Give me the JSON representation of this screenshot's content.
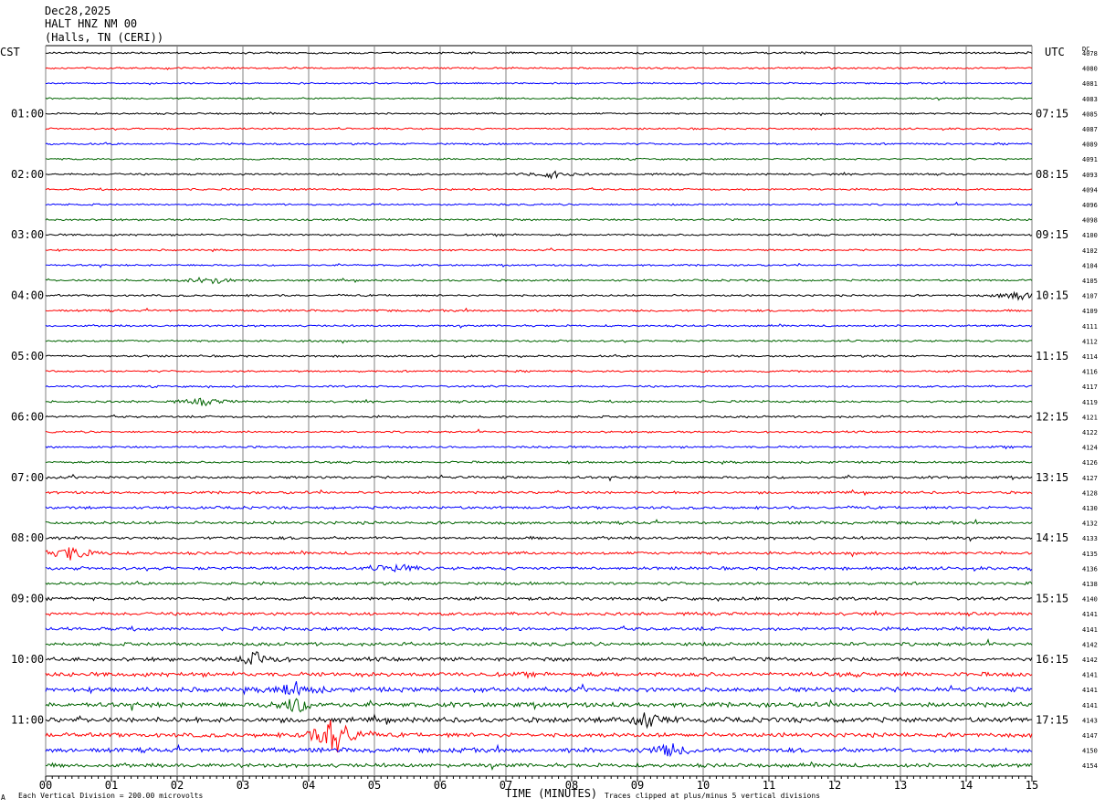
{
  "header": {
    "date": "Dec28,2025",
    "station": "HALT HNZ NM 00",
    "location": "(Halls, TN (CERI))"
  },
  "left_axis_label": "CST",
  "right_axis_label": "UTC",
  "dc_label": "DC",
  "footer": {
    "scale_note": "Each Vertical Division =  200.00 microvolts",
    "xlabel": "TIME (MINUTES)",
    "clip_note": "Traces clipped at plus/minus 5 vertical divisions",
    "corner_mark": "A"
  },
  "colors": {
    "trace_cycle": [
      "#000000",
      "#ff0000",
      "#0000ff",
      "#006400"
    ],
    "gridline": "#808080",
    "background": "#ffffff"
  },
  "chart_data": {
    "type": "line",
    "title": "HALT HNZ NM 00",
    "xlabel": "TIME (MINUTES)",
    "xlim": [
      0,
      15
    ],
    "x_ticks": [
      "00",
      "01",
      "02",
      "03",
      "04",
      "05",
      "06",
      "07",
      "08",
      "09",
      "10",
      "11",
      "12",
      "13",
      "14",
      "15"
    ],
    "row_minutes": 15,
    "trace_count": 48,
    "cst_hour_labels": [
      "01:00",
      "02:00",
      "03:00",
      "04:00",
      "05:00",
      "06:00",
      "07:00",
      "08:00",
      "09:00",
      "10:00",
      "11:00"
    ],
    "utc_hour_labels": [
      "07:15",
      "08:15",
      "09:15",
      "10:15",
      "11:15",
      "12:15",
      "13:15",
      "14:15",
      "15:15",
      "16:15",
      "17:15"
    ],
    "hour_label_rows": [
      4,
      8,
      12,
      16,
      20,
      24,
      28,
      32,
      36,
      40,
      44
    ],
    "dc_offsets": [
      4078,
      4080,
      4081,
      4083,
      4085,
      4087,
      4089,
      4091,
      4093,
      4094,
      4096,
      4098,
      4100,
      4102,
      4104,
      4105,
      4107,
      4109,
      4111,
      4112,
      4114,
      4116,
      4117,
      4119,
      4121,
      4122,
      4124,
      4126,
      4127,
      4128,
      4130,
      4132,
      4133,
      4135,
      4136,
      4138,
      4140,
      4141,
      4141,
      4142,
      4142,
      4141,
      4141,
      4141,
      4143,
      4147,
      4150,
      4154
    ],
    "trace_noise": [
      1.0,
      0.9,
      0.8,
      0.9,
      0.9,
      0.9,
      1.0,
      0.9,
      1.0,
      1.0,
      0.9,
      1.0,
      1.0,
      0.9,
      0.9,
      1.0,
      1.0,
      1.1,
      1.0,
      1.0,
      1.0,
      1.0,
      1.0,
      1.1,
      1.1,
      1.0,
      1.1,
      1.1,
      1.3,
      1.3,
      1.4,
      1.5,
      1.5,
      1.5,
      1.6,
      1.5,
      1.6,
      1.6,
      1.8,
      1.8,
      2.0,
      2.2,
      2.4,
      2.4,
      2.6,
      2.2,
      2.4,
      2.0
    ],
    "events": [
      {
        "trace": 8,
        "minute": 7.7,
        "amplitude": 4
      },
      {
        "trace": 15,
        "minute": 2.5,
        "amplitude": 5
      },
      {
        "trace": 16,
        "minute": 14.8,
        "amplitude": 5
      },
      {
        "trace": 23,
        "minute": 2.4,
        "amplitude": 4
      },
      {
        "trace": 33,
        "minute": 0.4,
        "amplitude": 8
      },
      {
        "trace": 34,
        "minute": 5.3,
        "amplitude": 5
      },
      {
        "trace": 40,
        "minute": 3.2,
        "amplitude": 7
      },
      {
        "trace": 42,
        "minute": 3.8,
        "amplitude": 8
      },
      {
        "trace": 43,
        "minute": 3.8,
        "amplitude": 9
      },
      {
        "trace": 44,
        "minute": 9.1,
        "amplitude": 9
      },
      {
        "trace": 45,
        "minute": 4.4,
        "amplitude": 22
      },
      {
        "trace": 46,
        "minute": 9.5,
        "amplitude": 7
      }
    ]
  }
}
